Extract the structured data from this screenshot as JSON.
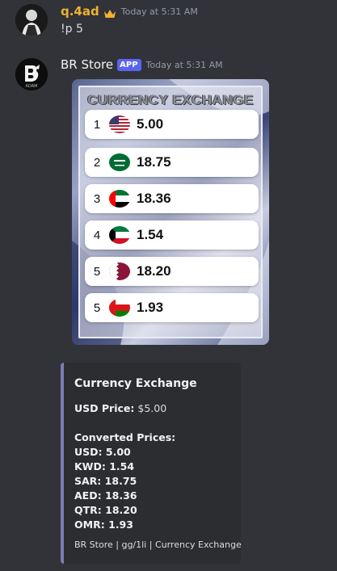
{
  "messages": [
    {
      "username": "q.4ad",
      "timestamp": "Today at 5:31 AM",
      "content": "!p 5",
      "crown_icon": "crown-icon"
    },
    {
      "username": "BR Store",
      "badge": "APP",
      "timestamp": "Today at 5:31 AM",
      "avatar_text": "ADAM"
    }
  ],
  "image": {
    "title": "CURRENCY EXCHANGE",
    "rows": [
      {
        "num": "1",
        "flag": "usa-flag",
        "value": "5.00"
      },
      {
        "num": "2",
        "flag": "saudi-flag",
        "value": "18.75"
      },
      {
        "num": "3",
        "flag": "uae-flag",
        "value": "18.36"
      },
      {
        "num": "4",
        "flag": "kuwait-flag",
        "value": "1.54"
      },
      {
        "num": "5",
        "flag": "qatar-flag",
        "value": "18.20"
      },
      {
        "num": "5",
        "flag": "oman-flag",
        "value": "1.93"
      }
    ]
  },
  "embed": {
    "accent_color": "#7b7fb0",
    "title": "Currency Exchange",
    "usd_label": "USD Price:",
    "usd_value": "$5.00",
    "converted_label": "Converted Prices:",
    "lines": [
      {
        "code": "USD:",
        "value": "5.00"
      },
      {
        "code": "KWD:",
        "value": "1.54"
      },
      {
        "code": "SAR:",
        "value": "18.75"
      },
      {
        "code": "AED:",
        "value": "18.36"
      },
      {
        "code": "QTR:",
        "value": "18.20"
      },
      {
        "code": "OMR:",
        "value": "1.93"
      }
    ],
    "footer": "BR Store | gg/1li | Currency Exchange"
  }
}
